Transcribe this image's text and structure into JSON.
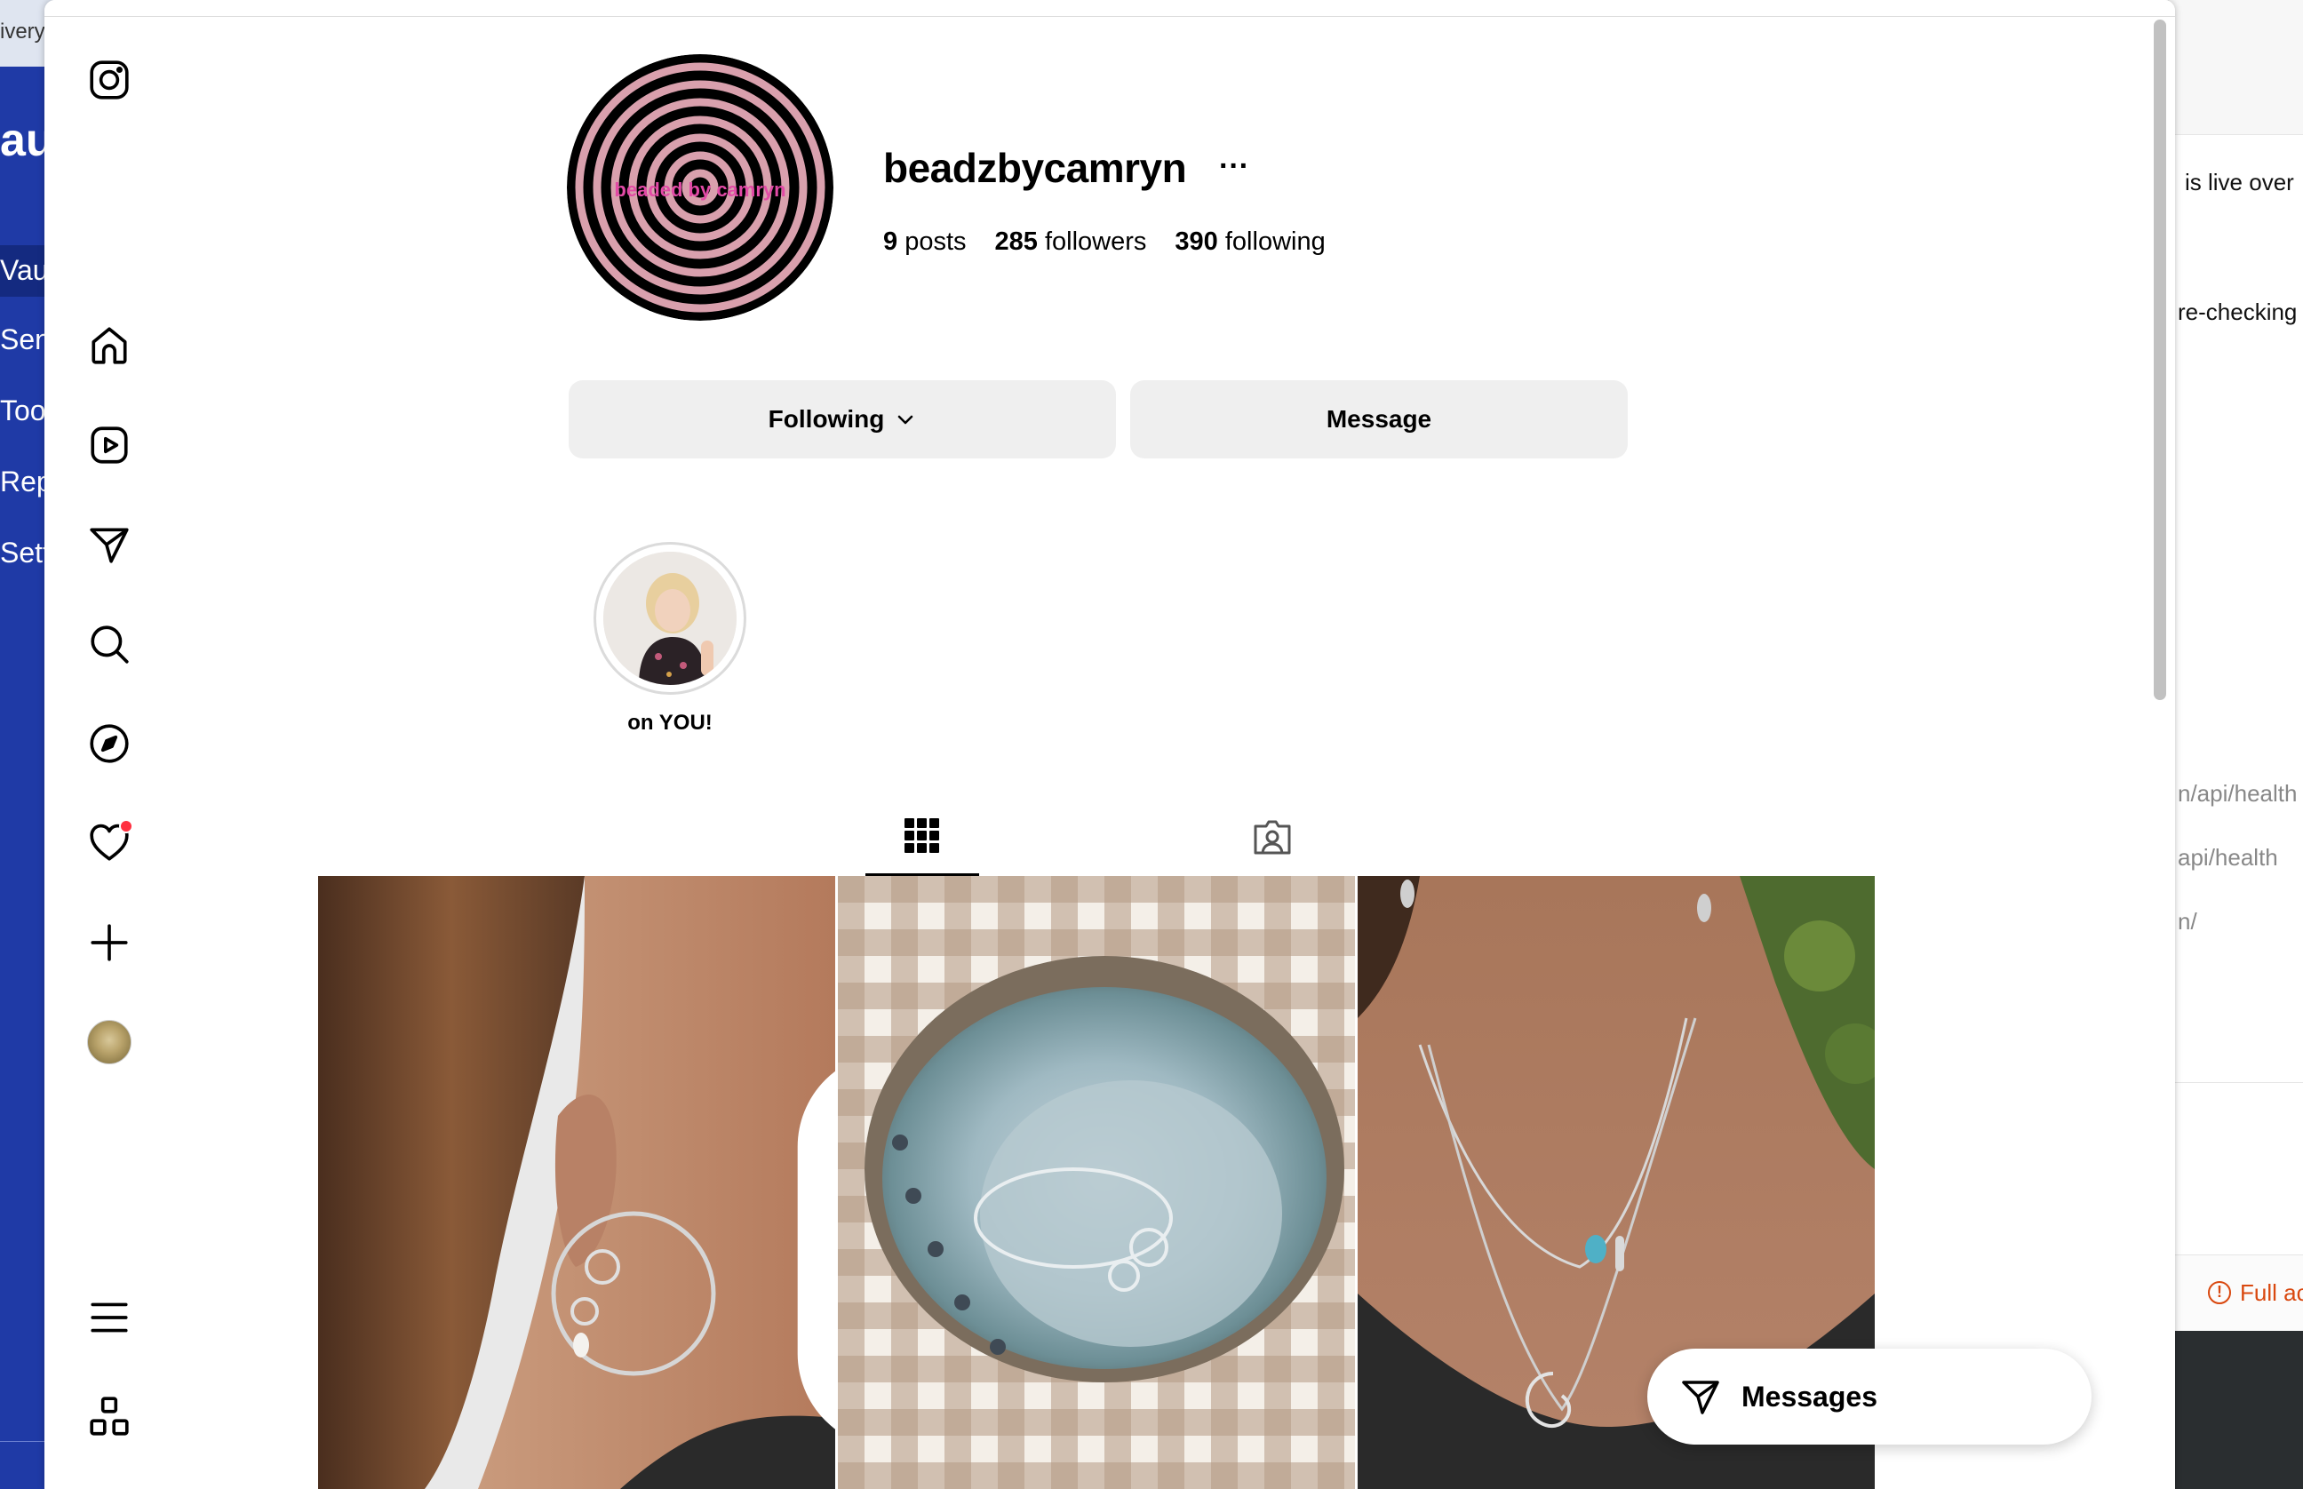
{
  "background_left": {
    "top_text": "ivery",
    "brand_text": "au",
    "nav": [
      "Vaul",
      "Send",
      "Tool",
      "Repo",
      "Setti"
    ]
  },
  "background_right": {
    "lines": [
      "is live over",
      "re-checking"
    ],
    "gray_lines": [
      "n/api/health",
      "api/health",
      "n/"
    ],
    "warning": "Full ac"
  },
  "profile": {
    "username": "beadzbycamryn",
    "more": "···",
    "avatar_text": "beaded by camryn",
    "posts_count": "9",
    "posts_label": "posts",
    "followers_count": "285",
    "followers_label": "followers",
    "following_count": "390",
    "following_label": "following"
  },
  "buttons": {
    "following": "Following",
    "message": "Message"
  },
  "highlights": [
    {
      "label": "on YOU!"
    }
  ],
  "tabs": [
    {
      "icon": "grid-icon",
      "active": true
    },
    {
      "icon": "tagged-icon",
      "active": false
    }
  ],
  "messages_pill": {
    "label": "Messages"
  },
  "colors": {
    "notification": "#ff3040",
    "button_bg": "#efefef",
    "profile_pink": "#d9a0ad"
  }
}
